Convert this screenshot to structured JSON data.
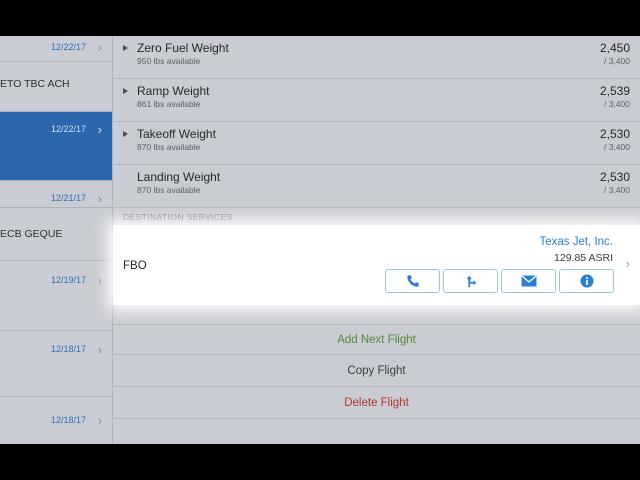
{
  "flights": [
    {
      "date": "12/22/17",
      "route": "",
      "selected": false
    },
    {
      "date": "",
      "route": "ETO TBC ACH",
      "selected": false
    },
    {
      "date": "12/22/17",
      "route": "",
      "selected": true
    },
    {
      "date": "12/21/17",
      "route": "",
      "selected": false
    },
    {
      "date": "",
      "route": "ECB GEQUE",
      "selected": false
    },
    {
      "date": "12/19/17",
      "route": "",
      "selected": false
    },
    {
      "date": "12/18/17",
      "route": "",
      "selected": false
    },
    {
      "date": "12/18/17",
      "route": "",
      "selected": false
    }
  ],
  "weights": [
    {
      "name": "Zero Fuel Weight",
      "available": "950 lbs available",
      "value": "2,450",
      "max": "/ 3,400",
      "expandable": true
    },
    {
      "name": "Ramp Weight",
      "available": "861 lbs available",
      "value": "2,539",
      "max": "/ 3,400",
      "expandable": true
    },
    {
      "name": "Takeoff Weight",
      "available": "870 lbs available",
      "value": "2,530",
      "max": "/ 3,400",
      "expandable": true
    },
    {
      "name": "Landing Weight",
      "available": "870 lbs available",
      "value": "2,530",
      "max": "/ 3,400",
      "expandable": false
    }
  ],
  "destination_services": {
    "header": "DESTINATION SERVICES",
    "fbo_label": "FBO",
    "fbo_name": "Texas Jet, Inc.",
    "fbo_price": "129.85 ASRI",
    "buttons": [
      "phone-icon",
      "directions-icon",
      "mail-icon",
      "info-icon"
    ]
  },
  "actions": {
    "add_next": "Add Next Flight",
    "copy": "Copy Flight",
    "delete": "Delete Flight"
  },
  "colors": {
    "accent_blue": "#2a7fd0",
    "selected_row": "#2a67ad",
    "add_green": "#4c8a3c",
    "delete_red": "#b2332b"
  }
}
